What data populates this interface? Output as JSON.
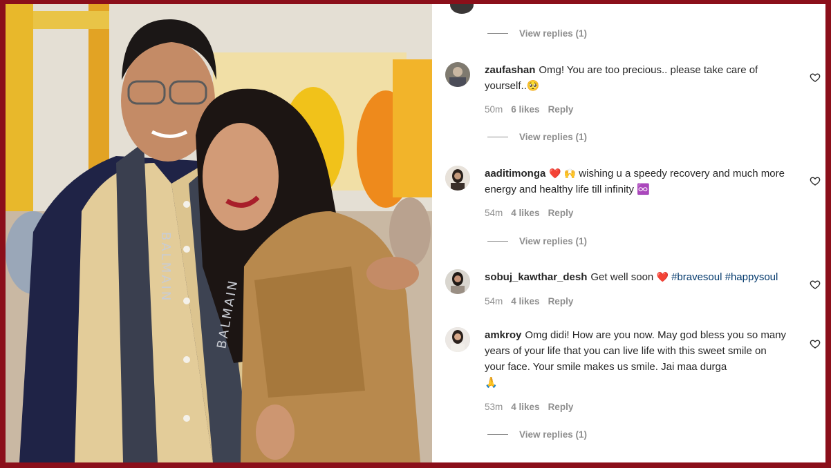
{
  "post": {
    "photo_description_icon": "photo-icon",
    "scarf_text": "BALMAIN"
  },
  "comments_panel": {
    "view_replies_label": "View replies (1)",
    "comments": [
      {
        "username": "zaufashan",
        "text": "Omg! You are too precious.. please take care of yourself..",
        "emoji": "🥺",
        "time": "50m",
        "likes": "6 likes",
        "reply_label": "Reply"
      },
      {
        "username": "aaditimonga",
        "emoji_lead": "❤️ 🙌",
        "text": "wishing u a speedy recovery and much more energy and healthy life till infinity",
        "emoji": "♾️",
        "time": "54m",
        "likes": "4 likes",
        "reply_label": "Reply"
      },
      {
        "username": "sobuj_kawthar_desh",
        "text": "Get well soon",
        "emoji": "❤️",
        "hashtag_1": "#bravesoul",
        "hashtag_2": "#happysoul",
        "time": "54m",
        "likes": "4 likes",
        "reply_label": "Reply"
      },
      {
        "username": "amkroy",
        "text": "Omg didi! How are you now. May god bless you so many years of your life that you can live life with this sweet smile on your face. Your smile makes us smile. Jai maa durga",
        "emoji": "🙏",
        "time": "53m",
        "likes": "4 likes",
        "reply_label": "Reply"
      }
    ]
  },
  "colors": {
    "border": "#8b0f1a",
    "username": "#262626",
    "meta": "#8e8e8e",
    "hashtag": "#00376b",
    "heart": "#e0142b"
  }
}
